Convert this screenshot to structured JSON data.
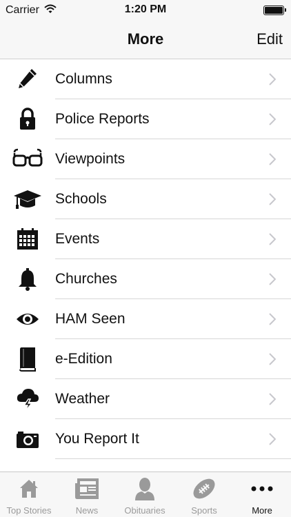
{
  "status_bar": {
    "carrier": "Carrier",
    "time": "1:20 PM"
  },
  "nav": {
    "title": "More",
    "edit_label": "Edit"
  },
  "list": {
    "items": [
      {
        "label": "Columns",
        "icon": "pencil-icon"
      },
      {
        "label": "Police Reports",
        "icon": "lock-icon"
      },
      {
        "label": "Viewpoints",
        "icon": "glasses-icon"
      },
      {
        "label": "Schools",
        "icon": "graduation-cap-icon"
      },
      {
        "label": "Events",
        "icon": "calendar-icon"
      },
      {
        "label": "Churches",
        "icon": "bell-icon"
      },
      {
        "label": "HAM Seen",
        "icon": "eye-icon"
      },
      {
        "label": "e-Edition",
        "icon": "book-icon"
      },
      {
        "label": "Weather",
        "icon": "storm-cloud-icon"
      },
      {
        "label": "You Report It",
        "icon": "camera-icon"
      }
    ]
  },
  "tab_bar": {
    "tabs": [
      {
        "label": "Top Stories",
        "icon": "house-icon"
      },
      {
        "label": "News",
        "icon": "newspaper-icon"
      },
      {
        "label": "Obituaries",
        "icon": "person-icon"
      },
      {
        "label": "Sports",
        "icon": "football-icon"
      },
      {
        "label": "More",
        "icon": "ellipsis-icon"
      }
    ],
    "active": "More"
  },
  "colors": {
    "text": "#111111",
    "inactive_tab": "#9a9a9a",
    "separator": "#d6d6d6",
    "chevron": "#c7c7cc",
    "bar_bg": "#f7f7f7"
  }
}
